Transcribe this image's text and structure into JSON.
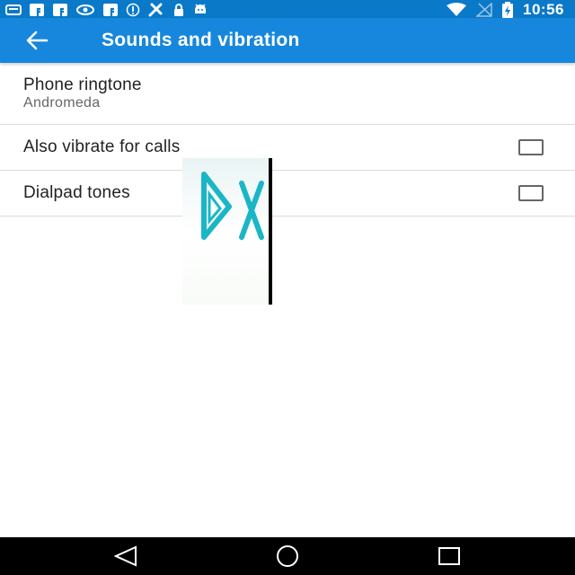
{
  "status_bar": {
    "time": "10:56",
    "left_icons": [
      "message-icon",
      "facebook-icon",
      "facebook-icon",
      "nvidia-icon",
      "facebook-icon",
      "info-icon",
      "tools-icon",
      "lock-icon",
      "android-icon"
    ],
    "right_icons": [
      "wifi-icon",
      "no-signal-icon",
      "battery-charging-icon"
    ]
  },
  "toolbar": {
    "title": "Sounds and vibration",
    "back_icon": "arrow-left-icon"
  },
  "settings": {
    "ringtone": {
      "title": "Phone ringtone",
      "summary": "Andromeda"
    },
    "vibrate": {
      "title": "Also vibrate for calls",
      "checked": false
    },
    "dialpad": {
      "title": "Dialpad tones",
      "checked": false
    }
  },
  "overlay": {
    "icon": "dx-logo-icon"
  },
  "nav_bar": {
    "icons": [
      "back-triangle-icon",
      "home-circle-icon",
      "recents-square-icon"
    ]
  },
  "colors": {
    "status_bar": "#0a79c8",
    "toolbar": "#1687dc",
    "overlay_accent": "#1bb6c6",
    "nav_bar": "#000000"
  }
}
